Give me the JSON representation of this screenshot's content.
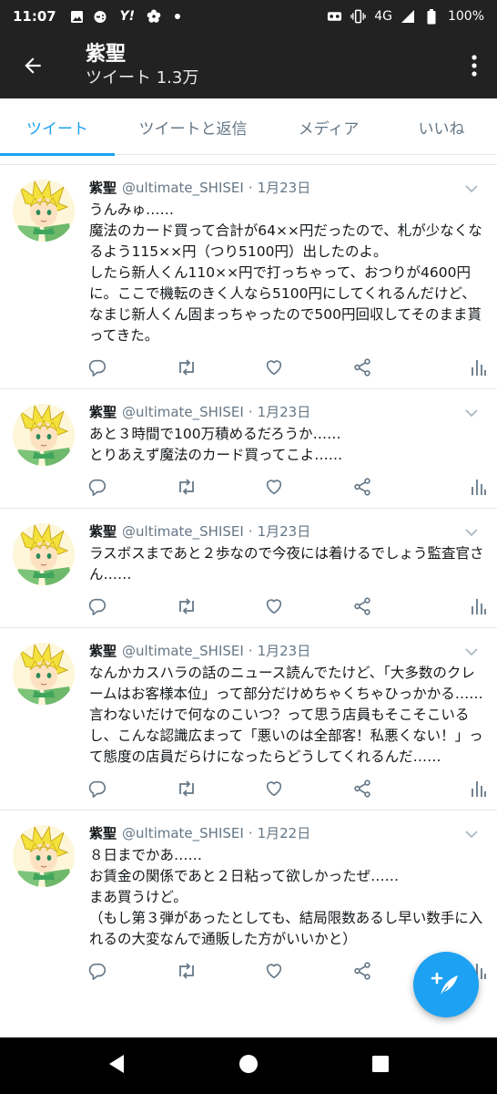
{
  "status_bar": {
    "time": "11:07",
    "network": "4G",
    "battery": "100%",
    "left_icons": [
      "image-icon",
      "game-controller-icon",
      "yahoo-icon",
      "cherry-blossom-icon",
      "dot-icon"
    ],
    "right_icons": [
      "vr-headset-icon",
      "vibrate-icon",
      "signal-icon",
      "battery-icon"
    ]
  },
  "header": {
    "name": "紫聖",
    "tweet_count": "ツイート 1.3万"
  },
  "tabs": [
    {
      "label": "ツイート",
      "active": true
    },
    {
      "label": "ツイートと返信",
      "active": false
    },
    {
      "label": "メディア",
      "active": false
    },
    {
      "label": "いいね",
      "active": false
    }
  ],
  "tweets": [
    {
      "name": "紫聖",
      "handle": "@ultimate_SHISEI",
      "separator": "·",
      "date": "1月23日",
      "text": "うんみゅ……\n魔法のカード買って合計が64××円だったので、札が少なくなるよう115××円（つり5100円）出したのよ。\nしたら新人くん110××円で打っちゃって、おつりが4600円に。ここで機転のきく人なら5100円にしてくれるんだけど、なまじ新人くん固まっちゃったので500円回収してそのまま貰ってきた。"
    },
    {
      "name": "紫聖",
      "handle": "@ultimate_SHISEI",
      "separator": "·",
      "date": "1月23日",
      "text": "あと３時間で100万積めるだろうか……\nとりあえず魔法のカード買ってこよ……"
    },
    {
      "name": "紫聖",
      "handle": "@ultimate_SHISEI",
      "separator": "·",
      "date": "1月23日",
      "text": "ラスボスまであと２歩なので今夜には着けるでしょう監査官さん……"
    },
    {
      "name": "紫聖",
      "handle": "@ultimate_SHISEI",
      "separator": "·",
      "date": "1月23日",
      "text": "なんかカスハラの話のニュース読んでたけど、「大多数のクレームはお客様本位」って部分だけめちゃくちゃひっかかる……\n言わないだけで何なのこいつ？って思う店員もそこそこいるし、こんな認識広まって「悪いのは全部客！私悪くない！」って態度の店員だらけになったらどうしてくれるんだ……"
    },
    {
      "name": "紫聖",
      "handle": "@ultimate_SHISEI",
      "separator": "·",
      "date": "1月22日",
      "text": "８日までかあ……\nお賃金の関係であと２日粘って欲しかったぜ……\nまあ買うけど。\n（もし第３弾があったとしても、結局限数あるし早い数手に入れるの大変なんで通販した方がいいかと）"
    }
  ],
  "colors": {
    "accent": "#1da1f2",
    "header_bg": "#222222",
    "icon_gray": "#657786"
  }
}
